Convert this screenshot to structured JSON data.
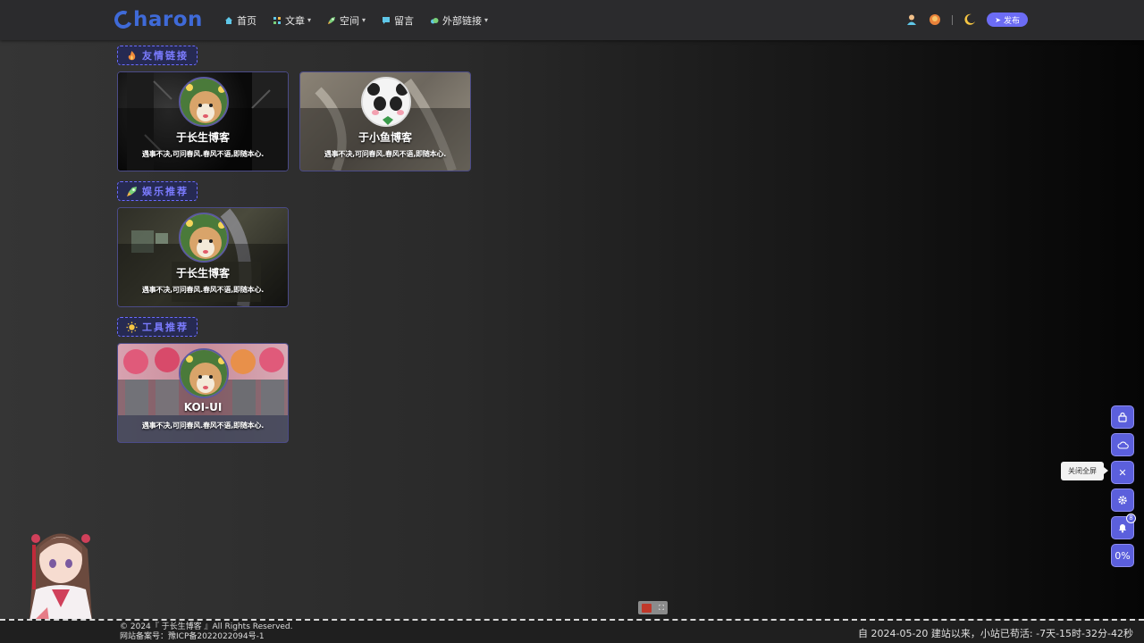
{
  "header": {
    "logo_text": "haron",
    "nav": [
      {
        "label": "首页",
        "icon": "home-icon",
        "has_dropdown": false
      },
      {
        "label": "文章",
        "icon": "grid-icon",
        "has_dropdown": true
      },
      {
        "label": "空间",
        "icon": "rocket-icon",
        "has_dropdown": true
      },
      {
        "label": "留言",
        "icon": "chat-icon",
        "has_dropdown": false
      },
      {
        "label": "外部链接",
        "icon": "cloud-icon",
        "has_dropdown": true
      }
    ],
    "publish_label": "发布"
  },
  "sections": [
    {
      "title": "友情链接",
      "icon": "fire-icon"
    },
    {
      "title": "娱乐推荐",
      "icon": "rocket-icon"
    },
    {
      "title": "工具推荐",
      "icon": "sun-icon"
    }
  ],
  "cards": [
    {
      "name": "于长生博客",
      "desc": "遇事不决,可问春风.春风不语,即随本心."
    },
    {
      "name": "于小鱼博客",
      "desc": "遇事不决,可问春风.春风不语,即随本心."
    },
    {
      "name": "于长生博客",
      "desc": "遇事不决,可问春风.春风不语,即随本心."
    },
    {
      "name": "KOI-UI",
      "desc": "遇事不决,可问春风.春风不语,即随本心."
    }
  ],
  "side_tools": {
    "tooltip": "关闭全屏",
    "notification_count": "8",
    "progress": "0%",
    "close_symbol": "✕"
  },
  "footer": {
    "copyright": "© 2024『 于长生博客 』All Rights Reserved.",
    "icp": "网站备案号：豫ICP备2022022094号-1",
    "uptime": "自 2024-05-20 建站以来，小站已苟活: -7天-15时-32分-42秒"
  },
  "colors": {
    "accent": "#5b5fdc",
    "logo": "#3f6ad8",
    "section_text": "#7b7bff"
  }
}
